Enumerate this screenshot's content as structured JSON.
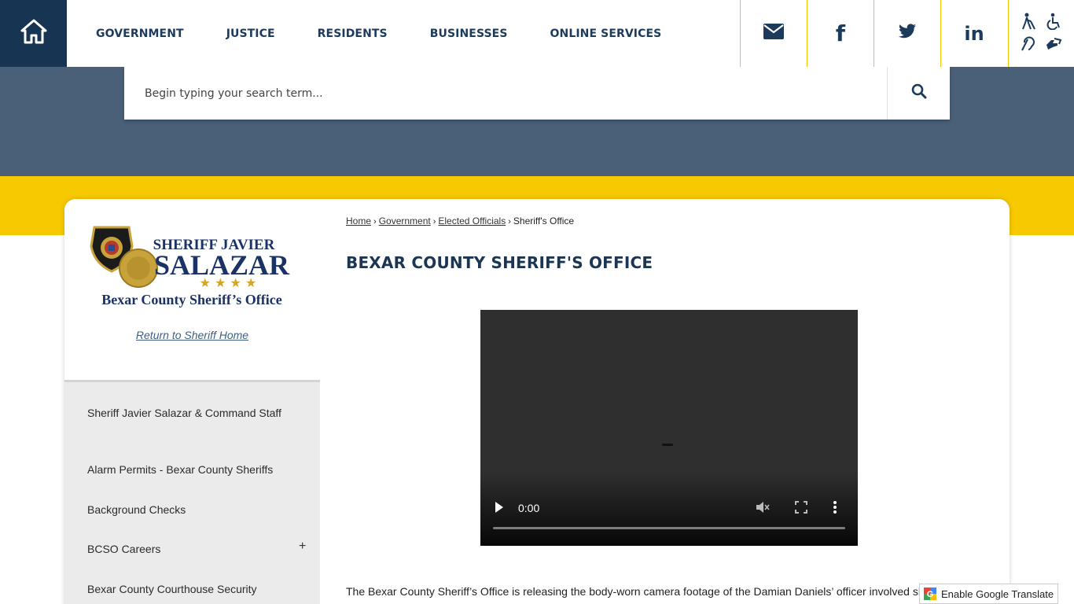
{
  "nav": {
    "items": [
      "GOVERNMENT",
      "JUSTICE",
      "RESIDENTS",
      "BUSINESSES",
      "ONLINE SERVICES"
    ]
  },
  "social": {
    "icons": [
      "mail-icon",
      "facebook-icon",
      "twitter-icon",
      "linkedin-icon"
    ],
    "facebook_glyph": "f",
    "linkedin_glyph": "in"
  },
  "search": {
    "placeholder": "Begin typing your search term..."
  },
  "sidebar": {
    "logo": {
      "line1": "SHERIFF JAVIER",
      "line2": "SALAZAR",
      "stars": "★ ★ ★ ★",
      "line3": "Bexar County Sheriff’s Office"
    },
    "return_link": "Return to Sheriff Home",
    "menu": [
      {
        "label": "Sheriff Javier Salazar & Command Staff"
      },
      {
        "label": "Alarm Permits - Bexar County Sheriffs"
      },
      {
        "label": "Background Checks"
      },
      {
        "label": "BCSO Careers",
        "expand": "+"
      },
      {
        "label": "Bexar County Courthouse Security"
      }
    ]
  },
  "breadcrumb": {
    "items": [
      "Home",
      "Government",
      "Elected Officials"
    ],
    "current": "Sheriff's Office",
    "separator": "›"
  },
  "main": {
    "title": "BEXAR COUNTY SHERIFF'S OFFICE",
    "video": {
      "time": "0:00",
      "progress": 0
    },
    "body": "The Bexar County Sheriff’s Office is releasing the body-worn camera footage of the Damian Daniels’ officer involved shooting"
  },
  "translate": {
    "label": "Enable Google Translate"
  },
  "colors": {
    "navy": "#173552",
    "band": "#4a5f78",
    "yellow": "#f6c900",
    "nav_text": "#1b3a5c"
  }
}
